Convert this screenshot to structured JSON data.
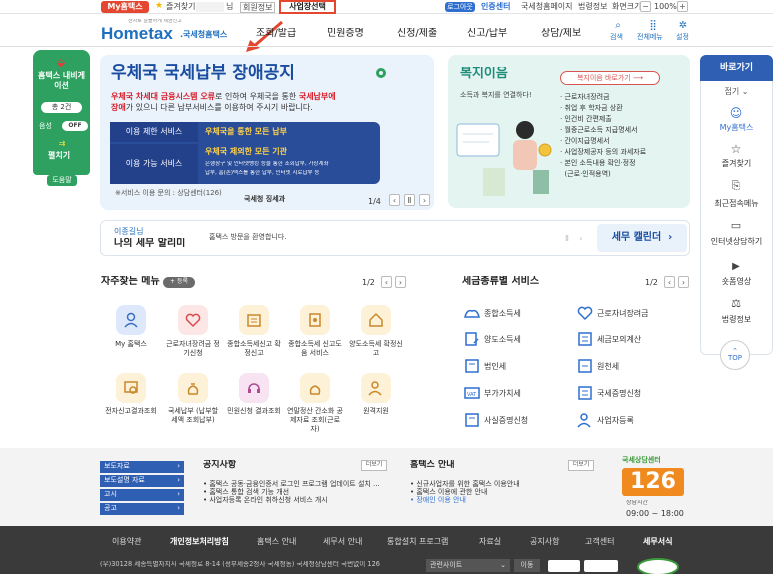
{
  "topbar": {
    "my_hometax": "My홈택스",
    "favorites": "즐겨찾기",
    "user_suffix": "님",
    "member_info": "회원정보",
    "business_select": "사업장선택",
    "logout": "로그아웃",
    "cert_center": "인증센터",
    "nts_home": "국세청홈페이지",
    "law_info": "법령정보",
    "screen_size": "화면크기",
    "zoom": "100%"
  },
  "header": {
    "logo_sub": "전자로 알뜰하게 세금신고",
    "logo": "Hometax",
    "logo_suffix": ".국세청홈택스",
    "nav": [
      "조회/발급",
      "민원증명",
      "신청/제출",
      "신고/납부",
      "상담/제보"
    ],
    "search": "검색",
    "all_menu": "전체메뉴",
    "settings": "설정"
  },
  "left_nav": {
    "title": "홈택스 내비게이션",
    "count": "총 2건",
    "voice_label": "음성",
    "voice_state": "OFF",
    "expand": "펼치기",
    "help": "도움말"
  },
  "banner": {
    "title": "우체국 국세납부 장애공지",
    "desc_red1": "우체국 차세대 금융시스템 오류",
    "desc_mid1": "로 인하여 우체국을 통한 ",
    "desc_red2": "국세납부에",
    "desc_red3": "장애",
    "desc_mid2": "가 있으니 다른 납부서비스를 이용하여 주시기 바랍니다.",
    "limit_label": "이용 제한 서비스",
    "limit_value": "우체국을 통한 모든 납부",
    "avail_label": "이용 가능 서비스",
    "avail_value": "우체국 제외한 모든 기관",
    "avail_detail1": "은행창구 및 인터넷뱅킹 등을 통한 조회납부, 가상계좌",
    "avail_detail2": "납부, 홈(손)택스를 통한 납부, 인터넷 지로납부 등",
    "inquiry": "※서비스 이용 문의 : 상담센터(126)",
    "org": "국세청 징세과",
    "page": "1/4"
  },
  "welfare": {
    "title": "복지이음",
    "subtitle": "소득과 복지를 연결하다!",
    "shortcut": "복지이음 바로가기",
    "items": [
      "근로자녀장려금",
      "취업 후 학자금 상환",
      "인건비 간편제출",
      "월중근로소득 지급명세서",
      "간이지급명세서",
      "사업장제공자 등의 과세자료",
      "본인 소득내용 확인·정정",
      "(근로·인적용역)"
    ]
  },
  "notice": {
    "user": "이종길님",
    "title": "나의 세무 알리미",
    "message": "홈택스 방문을 환영합니다.",
    "calendar": "세무 캘린더"
  },
  "favorites_menu": {
    "title": "자주찾는 메뉴",
    "add": "등록",
    "page": "1/2",
    "items": [
      "My 홈택스",
      "근로자녀장려금 정기신청",
      "종합소득세신고 확정신고",
      "종합소득세 신고도움 서비스",
      "양도소득세 확정신고",
      "전자신고결과조회",
      "국세납부 (납부할 세액 조회납부)",
      "민원신청 결과조회",
      "연말정산 간소화 공제자료 조회(근로자)",
      "원격지원"
    ]
  },
  "tax_services": {
    "title": "세금종류별 서비스",
    "page": "1/2",
    "items": [
      "종합소득세",
      "근로자녀장려금",
      "양도소득세",
      "세금모의계산",
      "법인세",
      "원천세",
      "부가가치세",
      "국세증명신청",
      "사실증명신청",
      "사업자등록"
    ]
  },
  "right_side": {
    "title": "바로가기",
    "collapse": "접기",
    "items": [
      "My홈택스",
      "즐겨찾기",
      "최근접속메뉴",
      "인터넷상담하기",
      "숏폼영상",
      "법령정보"
    ],
    "top": "TOP"
  },
  "bottom": {
    "quick_links": [
      "보도자료",
      "보도설명 자료",
      "고시",
      "공고"
    ],
    "notices_title": "공지사항",
    "more": "더보기",
    "notices": [
      "홈택스 공동·금융인증서 로그인 프로그램 업데이트 설치 ...",
      "홈택스 통합 검색 기능 개선",
      "사업자등록 온라인 취하신청 서비스 개시"
    ],
    "guide_title": "홈택스 안내",
    "guides": [
      "신규사업자를 위한 홈택스 이용안내",
      "홈택스 이용에 관한 안내",
      "장애인 이용 안내"
    ],
    "call_center": "국세상담센터",
    "call_number": "126",
    "call_hours_label": "상담시간",
    "call_hours": "09:00 ~ 18:00"
  },
  "footer": {
    "links": [
      "이용약관",
      "개인정보처리방침",
      "홈택스 안내",
      "세무서 안내",
      "통합설치 프로그램",
      "자료실",
      "공지사항",
      "고객센터",
      "세무서식"
    ],
    "address": "(우)30128 세종특별자치시 국세청로 8-14 (정부세종2청사 국세청동) 국세청상담센터 국번없이 126",
    "related_site": "관련사이트",
    "go": "이동"
  },
  "colors": {
    "accent_blue": "#1a6fd1",
    "nav_green": "#2e9f5e",
    "red": "#d61f2b",
    "footer_dark": "#3a3a3a"
  }
}
